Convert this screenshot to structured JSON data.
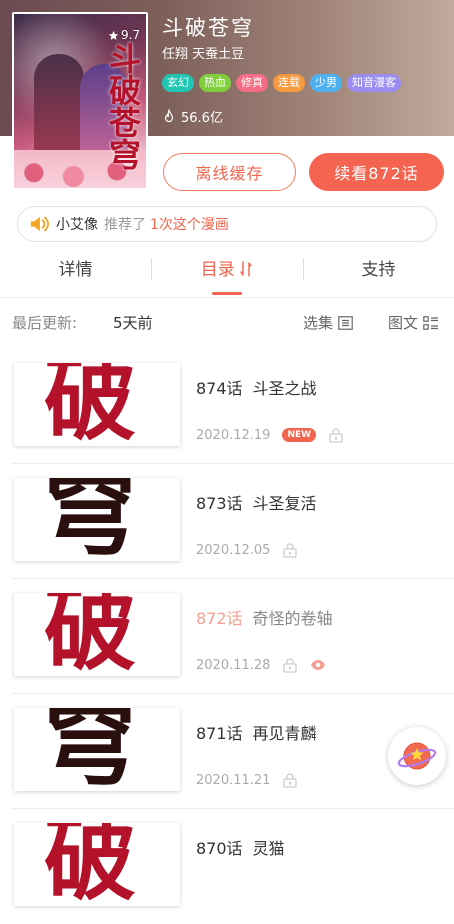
{
  "comic": {
    "title": "斗破苍穹",
    "author": "任翔 天蚕土豆",
    "rating": "9.7",
    "cover_text": "斗破苍穹",
    "popularity": "56.6亿",
    "tags": [
      {
        "label": "玄幻",
        "color": "#21c6b3"
      },
      {
        "label": "热血",
        "color": "#7fcf3a"
      },
      {
        "label": "修真",
        "color": "#f46d84"
      },
      {
        "label": "连载",
        "color": "#f79a3e"
      },
      {
        "label": "少男",
        "color": "#4fb0f0"
      },
      {
        "label": "知音漫客",
        "color": "#9b8cf0"
      }
    ]
  },
  "actions": {
    "offline_label": "离线缓存",
    "continue_label": "续看872话"
  },
  "recommend": {
    "user": "小艾像",
    "text": "推荐了",
    "count_text": "1次这个漫画"
  },
  "tabs": [
    {
      "label": "详情",
      "active": false
    },
    {
      "label": "目录",
      "active": true
    },
    {
      "label": "支持",
      "active": false
    }
  ],
  "catalog": {
    "update_label": "最后更新:",
    "update_value": "5天前",
    "select_label": "选集",
    "view_label": "图文"
  },
  "episodes": [
    {
      "number": "874话",
      "name": "斗圣之战",
      "date": "2020.12.19",
      "new": "NEW",
      "cover_glyph": "破",
      "read": false
    },
    {
      "number": "873话",
      "name": "斗圣复活",
      "date": "2020.12.05",
      "cover_glyph": "穹",
      "read": false
    },
    {
      "number": "872话",
      "name": "奇怪的卷轴",
      "date": "2020.11.28",
      "cover_glyph": "破",
      "read": true
    },
    {
      "number": "871话",
      "name": "再见青麟",
      "date": "2020.11.21",
      "cover_glyph": "穹",
      "read": false
    },
    {
      "number": "870话",
      "name": "灵猫",
      "date": "",
      "cover_glyph": "破",
      "read": false
    }
  ],
  "colors": {
    "accent": "#f0654d",
    "accent_light": "#f49f91"
  }
}
